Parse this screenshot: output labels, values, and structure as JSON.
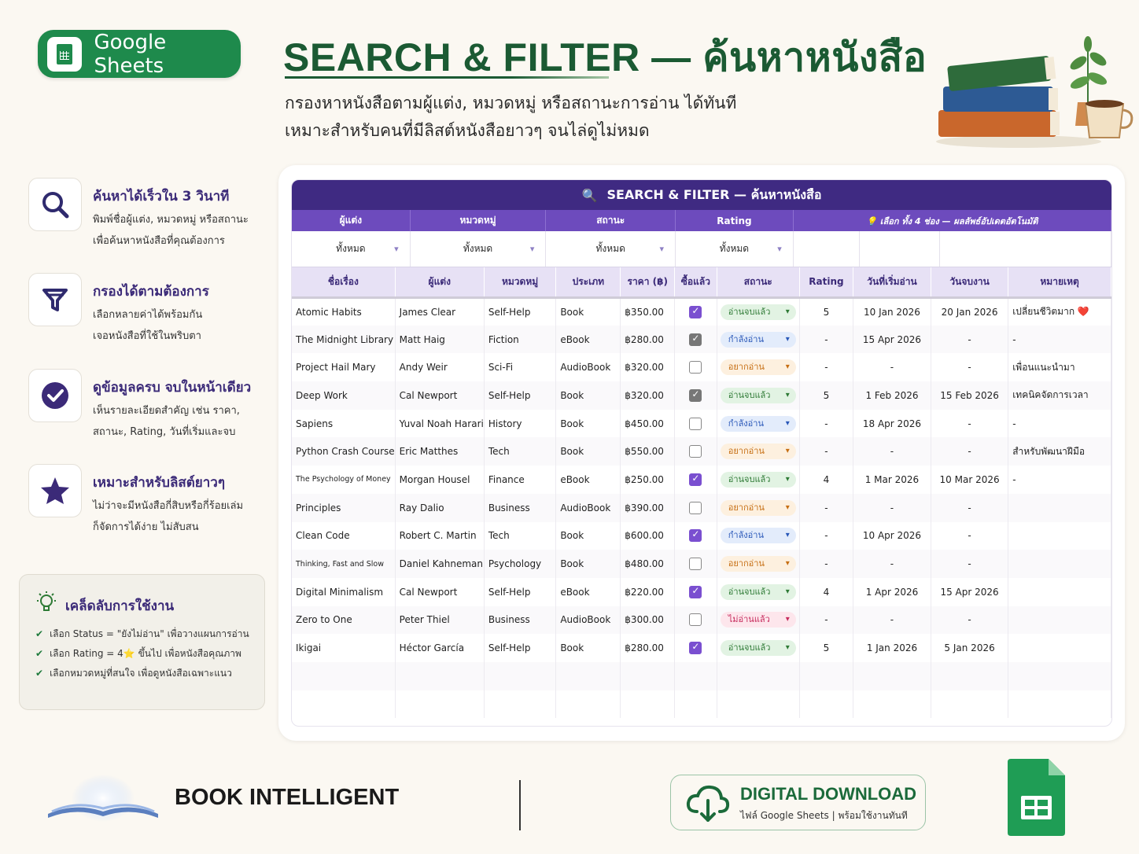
{
  "badge": {
    "label": "Google Sheets"
  },
  "header": {
    "title": "SEARCH & FILTER — ค้นหาหนังสือ",
    "subtitle_1": "กรองหาหนังสือตามผู้แต่ง, หมวดหมู่ หรือสถานะการอ่าน ได้ทันที",
    "subtitle_2": "เหมาะสำหรับคนที่มีลิสต์หนังสือยาวๆ จนไล่ดูไม่หมด"
  },
  "features": [
    {
      "icon": "search-icon",
      "title": "ค้นหาได้เร็วใน 3 วินาที",
      "line1": "พิมพ์ชื่อผู้แต่ง, หมวดหมู่ หรือสถานะ",
      "line2": "เพื่อค้นหาหนังสือที่คุณต้องการ"
    },
    {
      "icon": "filter-icon",
      "title": "กรองได้ตามต้องการ",
      "line1": "เลือกหลายค่าได้พร้อมกัน",
      "line2": "เจอหนังสือที่ใช้ในพริบตา"
    },
    {
      "icon": "check-circle-icon",
      "title": "ดูข้อมูลครบ จบในหน้าเดียว",
      "line1": "เห็นรายละเอียดสำคัญ เช่น ราคา,",
      "line2": "สถานะ, Rating, วันที่เริ่มและจบ"
    },
    {
      "icon": "star-icon",
      "title": "เหมาะสำหรับลิสต์ยาวๆ",
      "line1": "ไม่ว่าจะมีหนังสือกี่สิบหรือกี่ร้อยเล่ม",
      "line2": "ก็จัดการได้ง่าย ไม่สับสน"
    }
  ],
  "tips": {
    "title": "เคล็ดลับการใช้งาน",
    "items": [
      "เลือก Status = \"ยังไม่อ่าน\" เพื่อวางแผนการอ่าน",
      "เลือก Rating = 4⭐ ขึ้นไป เพื่อหนังสือคุณภาพ",
      "เลือกหมวดหมู่ที่สนใจ เพื่อดูหนังสือเฉพาะแนว"
    ]
  },
  "sheet": {
    "bar_title": "SEARCH & FILTER — ค้นหาหนังสือ",
    "filter_labels": [
      "ผู้แต่ง",
      "หมวดหมู่",
      "สถานะ",
      "Rating"
    ],
    "filter_hint": "💡 เลือก ทั้ง 4 ช่อง — ผลลัพธ์อัปเดตอัตโนมัติ",
    "filter_values": [
      "ทั้งหมด",
      "ทั้งหมด",
      "ทั้งหมด",
      "ทั้งหมด"
    ],
    "columns": [
      "ชื่อเรื่อง",
      "ผู้แต่ง",
      "หมวดหมู่",
      "ประเภท",
      "ราคา (฿)",
      "ซื้อแล้ว",
      "สถานะ",
      "Rating",
      "วันที่เริ่มอ่าน",
      "วันจบงาน",
      "หมายเหตุ"
    ],
    "rows": [
      {
        "title": "Atomic Habits",
        "author": "James Clear",
        "category": "Self-Help",
        "type": "Book",
        "price": "฿350.00",
        "bought": "on",
        "status": "อ่านจบแล้ว",
        "status_kind": "done",
        "rating": "5",
        "start": "10 Jan 2026",
        "end": "20 Jan 2026",
        "note": "เปลี่ยนชีวิตมาก ❤️"
      },
      {
        "title": "The Midnight Library",
        "author": "Matt Haig",
        "category": "Fiction",
        "type": "eBook",
        "price": "฿280.00",
        "bought": "grey",
        "status": "กำลังอ่าน",
        "status_kind": "read",
        "rating": "-",
        "start": "15 Apr 2026",
        "end": "-",
        "note": "-"
      },
      {
        "title": "Project Hail Mary",
        "author": "Andy Weir",
        "category": "Sci-Fi",
        "type": "AudioBook",
        "price": "฿320.00",
        "bought": "off",
        "status": "อยากอ่าน",
        "status_kind": "want",
        "rating": "-",
        "start": "-",
        "end": "-",
        "note": "เพื่อนแนะนำมา"
      },
      {
        "title": "Deep Work",
        "author": "Cal Newport",
        "category": "Self-Help",
        "type": "Book",
        "price": "฿320.00",
        "bought": "grey",
        "status": "อ่านจบแล้ว",
        "status_kind": "done",
        "rating": "5",
        "start": "1 Feb 2026",
        "end": "15 Feb 2026",
        "note": "เทคนิคจัดการเวลา"
      },
      {
        "title": "Sapiens",
        "author": "Yuval Noah Harari",
        "category": "History",
        "type": "Book",
        "price": "฿450.00",
        "bought": "off",
        "status": "กำลังอ่าน",
        "status_kind": "read",
        "rating": "-",
        "start": "18 Apr 2026",
        "end": "-",
        "note": "-"
      },
      {
        "title": "Python Crash Course",
        "author": "Eric Matthes",
        "category": "Tech",
        "type": "Book",
        "price": "฿550.00",
        "bought": "off",
        "status": "อยากอ่าน",
        "status_kind": "want",
        "rating": "-",
        "start": "-",
        "end": "-",
        "note": "สำหรับพัฒนาฝีมือ"
      },
      {
        "title": "The Psychology of Money",
        "author": "Morgan Housel",
        "category": "Finance",
        "type": "eBook",
        "price": "฿250.00",
        "bought": "on",
        "status": "อ่านจบแล้ว",
        "status_kind": "done",
        "rating": "4",
        "start": "1 Mar 2026",
        "end": "10 Mar 2026",
        "note": "-",
        "small": true
      },
      {
        "title": "Principles",
        "author": "Ray Dalio",
        "category": "Business",
        "type": "AudioBook",
        "price": "฿390.00",
        "bought": "off",
        "status": "อยากอ่าน",
        "status_kind": "want",
        "rating": "-",
        "start": "-",
        "end": "-",
        "note": ""
      },
      {
        "title": "Clean Code",
        "author": "Robert C. Martin",
        "category": "Tech",
        "type": "Book",
        "price": "฿600.00",
        "bought": "on",
        "status": "กำลังอ่าน",
        "status_kind": "read",
        "rating": "-",
        "start": "10 Apr 2026",
        "end": "-",
        "note": ""
      },
      {
        "title": "Thinking, Fast and Slow",
        "author": "Daniel Kahneman",
        "category": "Psychology",
        "type": "Book",
        "price": "฿480.00",
        "bought": "off",
        "status": "อยากอ่าน",
        "status_kind": "want",
        "rating": "-",
        "start": "-",
        "end": "-",
        "note": "",
        "small": true
      },
      {
        "title": "Digital Minimalism",
        "author": "Cal Newport",
        "category": "Self-Help",
        "type": "eBook",
        "price": "฿220.00",
        "bought": "on",
        "status": "อ่านจบแล้ว",
        "status_kind": "done",
        "rating": "4",
        "start": "1 Apr 2026",
        "end": "15 Apr 2026",
        "note": ""
      },
      {
        "title": "Zero to One",
        "author": "Peter Thiel",
        "category": "Business",
        "type": "AudioBook",
        "price": "฿300.00",
        "bought": "off",
        "status": "ไม่อ่านแล้ว",
        "status_kind": "nope",
        "rating": "-",
        "start": "-",
        "end": "-",
        "note": ""
      },
      {
        "title": "Ikigai",
        "author": "Héctor García",
        "category": "Self-Help",
        "type": "Book",
        "price": "฿280.00",
        "bought": "on",
        "status": "อ่านจบแล้ว",
        "status_kind": "done",
        "rating": "5",
        "start": "1 Jan 2026",
        "end": "5 Jan 2026",
        "note": ""
      }
    ]
  },
  "footer": {
    "brand": "BOOK INTELLIGENT",
    "download_title": "DIGITAL DOWNLOAD",
    "download_sub": "ไฟล์ Google Sheets | พร้อมใช้งานทันที"
  },
  "colors": {
    "brand_green": "#1e8a4c",
    "title_green": "#1b5a33",
    "purple_bar": "#3f2a82",
    "filter_purple": "#6d4bbd",
    "accent_purple": "#3b2a78"
  }
}
